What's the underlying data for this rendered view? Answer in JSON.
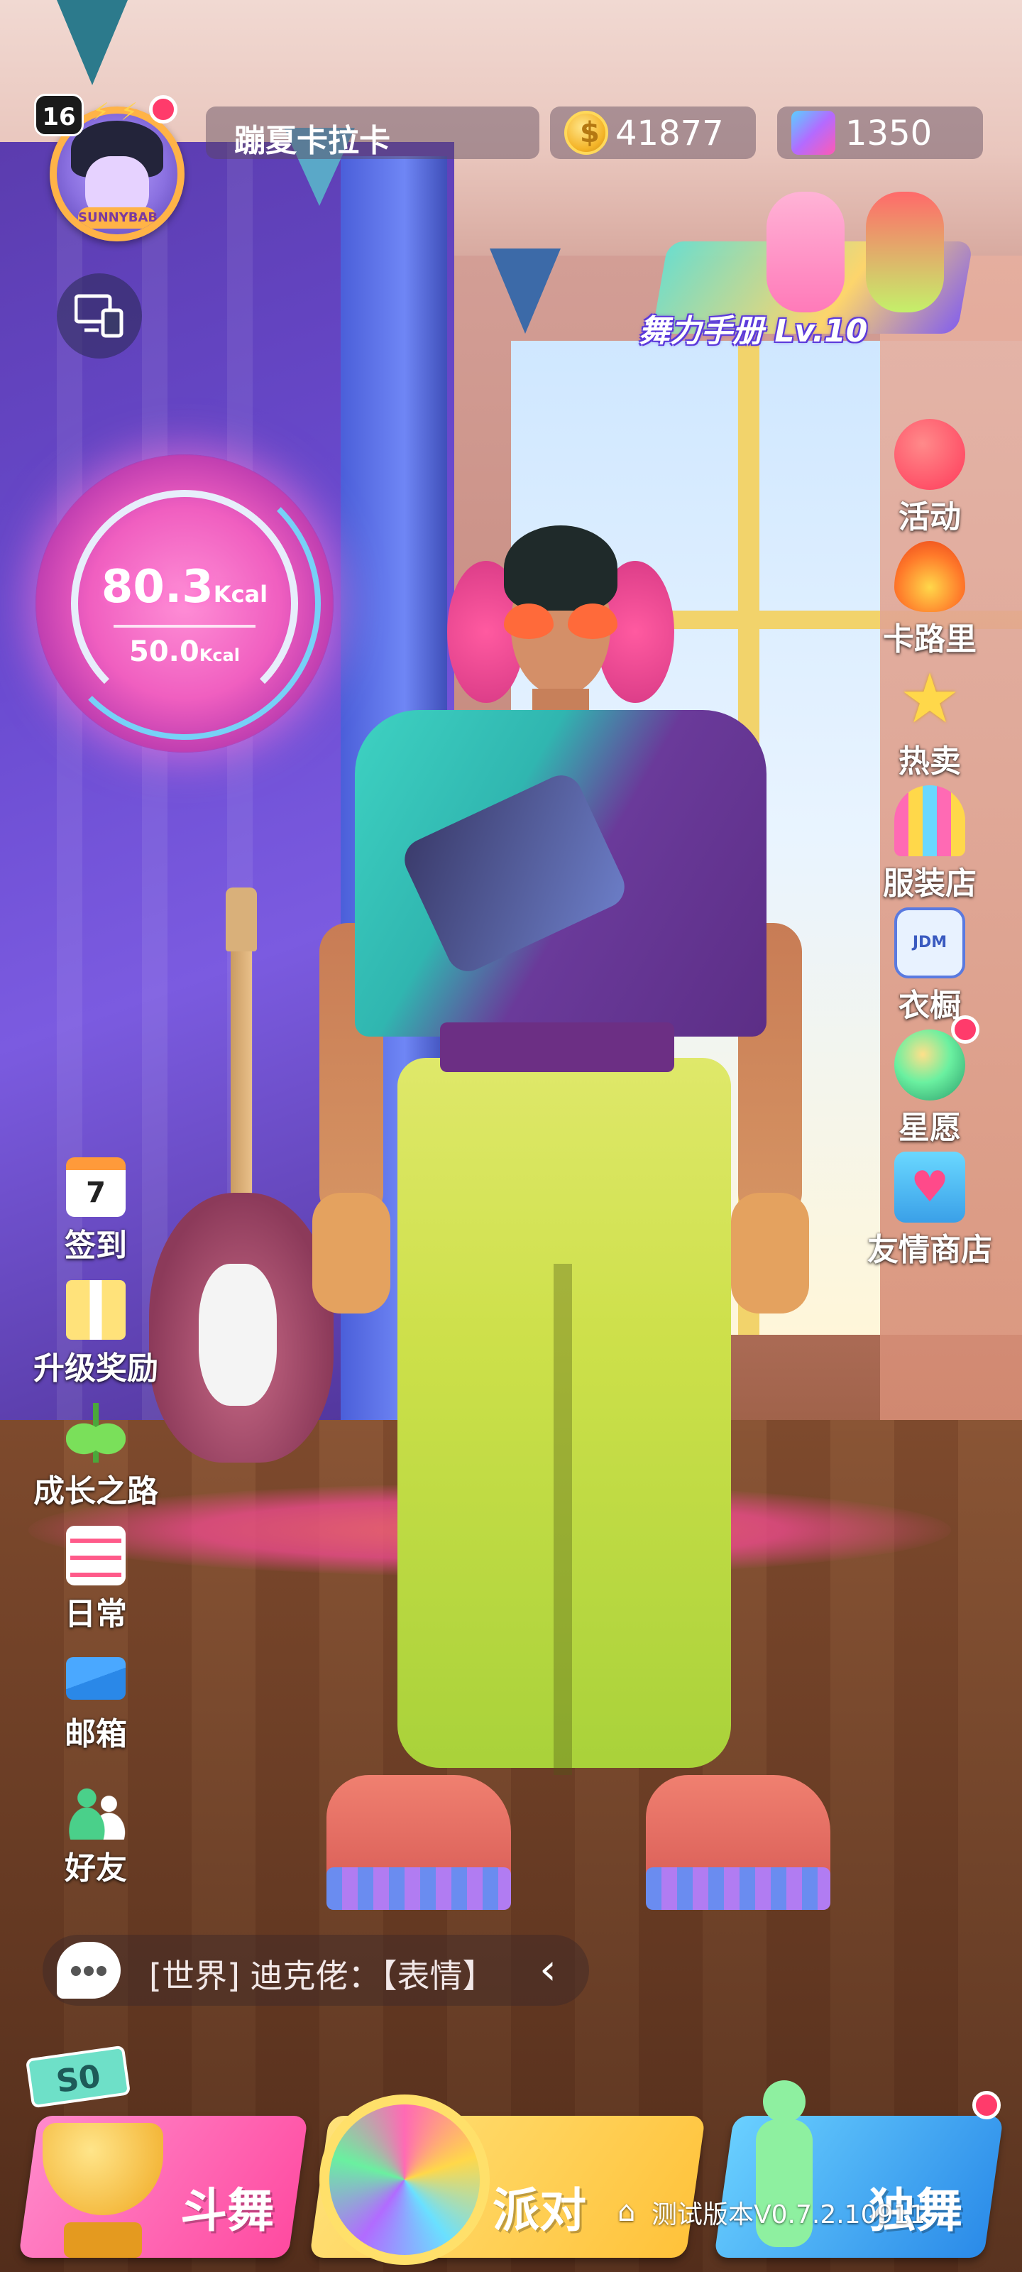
{
  "player": {
    "level": "16",
    "name": "蹦夏卡拉卡",
    "coins": "41877",
    "gems": "1350",
    "avatar_badge": "SUNNYBAB"
  },
  "dance_manual": {
    "label": "舞力手册 Lv.10"
  },
  "kcal": {
    "current": "80.3",
    "current_unit": "Kcal",
    "goal": "50.0",
    "goal_unit": "Kcal"
  },
  "right_menu": [
    {
      "label": "活动",
      "icon": "balloons-icon",
      "color": "#ff5a6a"
    },
    {
      "label": "卡路里",
      "icon": "flame-icon",
      "color": "#ff7a2a"
    },
    {
      "label": "热卖",
      "icon": "star-icon",
      "color": "#ffd84a"
    },
    {
      "label": "服装店",
      "icon": "shop-awning-icon",
      "color": "#ff6ab4"
    },
    {
      "label": "衣橱",
      "icon": "shirt-icon",
      "color": "#e8f2ff"
    },
    {
      "label": "星愿",
      "icon": "wish-orb-icon",
      "color": "#6af0a0"
    },
    {
      "label": "友情商店",
      "icon": "gift-bag-icon",
      "color": "#6ad8ff"
    }
  ],
  "left_menu": [
    {
      "label": "签到",
      "icon": "calendar-icon",
      "badge": "7"
    },
    {
      "label": "升级奖励",
      "icon": "gift-box-icon"
    },
    {
      "label": "成长之路",
      "icon": "sprout-icon"
    },
    {
      "label": "日常",
      "icon": "checklist-icon"
    },
    {
      "label": "邮箱",
      "icon": "mail-icon"
    },
    {
      "label": "好友",
      "icon": "friends-icon"
    }
  ],
  "chat": {
    "text": "[世界] 迪克佬：【表情】",
    "arrow": "‹"
  },
  "bottom": {
    "season": "S0",
    "battle_label": "斗舞",
    "party_label": "派对",
    "solo_label": "独舞",
    "version": "测试版本V0.7.2.10911"
  },
  "colors": {
    "battle_btn": "#ff5aa8",
    "party_btn": "#ffd24a",
    "solo_btn": "#3fa8ff",
    "notice_dot": "#ff3b6b"
  }
}
